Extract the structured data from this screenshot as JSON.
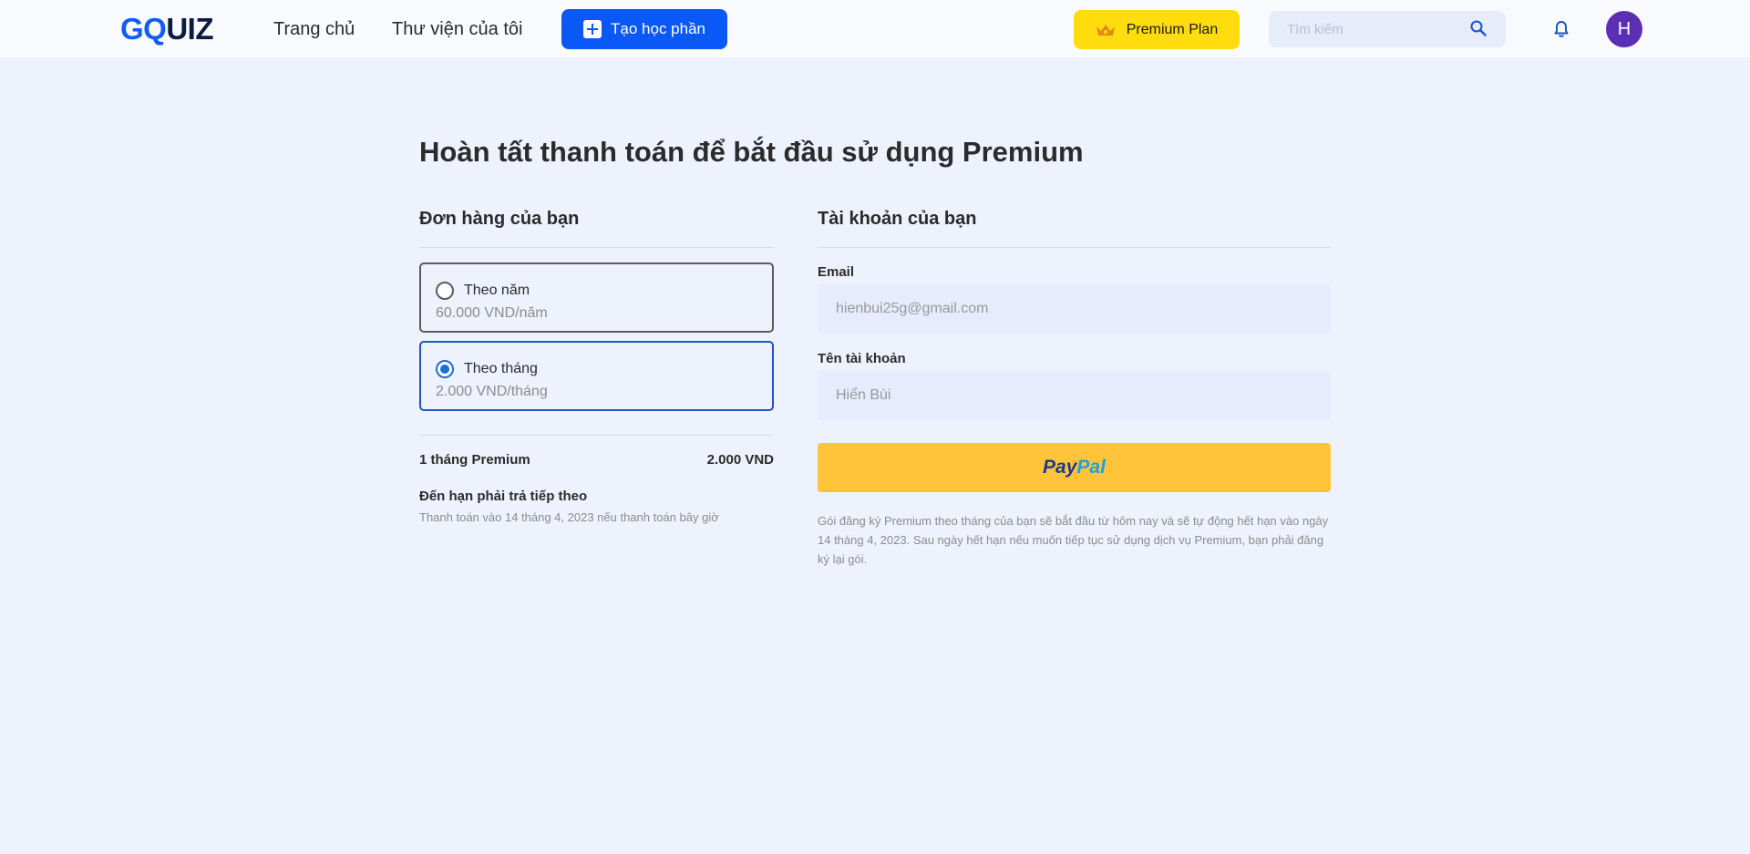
{
  "header": {
    "logo_part1": "GQ",
    "logo_part2": "UIZ",
    "nav_home": "Trang chủ",
    "nav_library": "Thư viện của tôi",
    "create_button": "Tạo học phần",
    "premium_button": "Premium Plan",
    "search_placeholder": "Tìm kiếm",
    "avatar_initial": "H"
  },
  "main": {
    "title": "Hoàn tất thanh toán để bắt đầu sử dụng Premium",
    "order": {
      "section_title": "Đơn hàng của bạn",
      "plans": [
        {
          "name": "Theo năm",
          "price": "60.000 VND/năm",
          "selected": false
        },
        {
          "name": "Theo tháng",
          "price": "2.000 VND/tháng",
          "selected": true
        }
      ],
      "summary_label": "1 tháng Premium",
      "summary_value": "2.000 VND",
      "due_title": "Đến hạn phải trả tiếp theo",
      "due_text": "Thanh toán vào 14 tháng 4, 2023 nếu thanh toán bây giờ"
    },
    "account": {
      "section_title": "Tài khoản của bạn",
      "email_label": "Email",
      "email_value": "hienbui25g@gmail.com",
      "username_label": "Tên tài khoản",
      "username_value": "Hiển Bùi",
      "paypal_part1": "Pay",
      "paypal_part2": "Pal",
      "note": "Gói đăng ký Premium theo tháng của bạn sẽ bắt đầu từ hôm nay và sẽ tự động hết hạn vào ngày 14 tháng 4, 2023. Sau ngày hết hạn nếu muốn tiếp tục sử dụng dịch vụ Premium, bạn phải đăng ký lại gói."
    }
  },
  "colors": {
    "primary": "#0a58f5",
    "premium": "#ffdc0d",
    "paypal_button": "#ffc43a",
    "background": "#eef2fc",
    "avatar": "#5a2fb3"
  },
  "icons": [
    "plus-icon",
    "crown-icon",
    "search-icon",
    "bell-icon"
  ]
}
